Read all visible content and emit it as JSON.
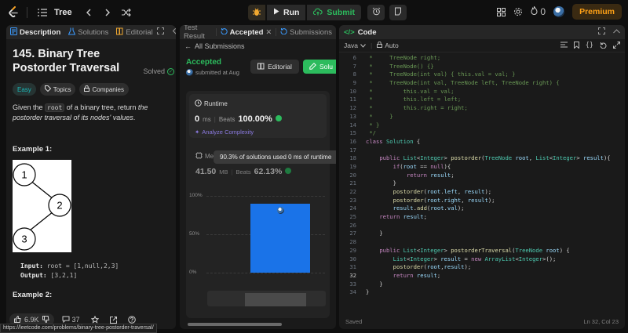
{
  "topbar": {
    "title": "Tree",
    "run_label": "Run",
    "submit_label": "Submit",
    "streak_count": "0",
    "premium_label": "Premium"
  },
  "description": {
    "tabs": [
      {
        "label": "Description"
      },
      {
        "label": "Solutions"
      },
      {
        "label": "Editorial"
      }
    ],
    "title": "145. Binary Tree Postorder Traversal",
    "status": "Solved",
    "tags": [
      "Easy",
      "Topics",
      "Companies"
    ],
    "text_before": "Given the ",
    "text_code": "root",
    "text_mid": " of a binary tree, return ",
    "text_em": "the postorder traversal of its nodes' values",
    "text_end": ".",
    "example1_title": "Example 1:",
    "tree_nodes": [
      "1",
      "2",
      "3"
    ],
    "input_label": "Input:",
    "input_value": "root = [1,null,2,3]",
    "output_label": "Output:",
    "output_value": "[3,2,1]",
    "example2_title": "Example 2:",
    "likes": "6.9K",
    "comments": "37"
  },
  "submission": {
    "tabs": [
      {
        "label": "Test Result"
      },
      {
        "label": "Accepted"
      },
      {
        "label": "Submissions"
      }
    ],
    "back_label": "All Submissions",
    "status": "Accepted",
    "submitted_text": "submitted at Aug",
    "editorial_label": "Editorial",
    "solution_label": "Solu",
    "runtime_label": "Runtime",
    "runtime_value": "0",
    "runtime_unit": "ms",
    "beats_label": "Beats",
    "runtime_beats": "100.00%",
    "analyze_label": "Analyze Complexity",
    "memory_label": "Memory",
    "memory_value": "41.50",
    "memory_unit": "MB",
    "memory_beats": "62.13%",
    "tooltip": "90.3% of solutions used 0 ms of runtime"
  },
  "chart_data": {
    "type": "bar",
    "y_ticks": [
      "100%",
      "50%",
      "0%"
    ],
    "ylim": [
      0,
      100
    ],
    "categories": [
      "0 ms"
    ],
    "values": [
      90.3
    ],
    "bar_color": "#1a73e8"
  },
  "code": {
    "title": "Code",
    "language": "Java",
    "mode": "Auto",
    "saved_label": "Saved",
    "cursor_pos": "Ln 32, Col 23",
    "lines": [
      {
        "n": "6",
        "t": " *     TreeNode right;"
      },
      {
        "n": "7",
        "t": " *     TreeNode() {}"
      },
      {
        "n": "8",
        "t": " *     TreeNode(int val) { this.val = val; }"
      },
      {
        "n": "9",
        "t": " *     TreeNode(int val, TreeNode left, TreeNode right) {"
      },
      {
        "n": "10",
        "t": " *         this.val = val;"
      },
      {
        "n": "11",
        "t": " *         this.left = left;"
      },
      {
        "n": "12",
        "t": " *         this.right = right;"
      },
      {
        "n": "13",
        "t": " *     }"
      },
      {
        "n": "14",
        "t": " * }"
      },
      {
        "n": "15",
        "t": " */"
      },
      {
        "n": "16",
        "t": "class Solution {"
      },
      {
        "n": "17",
        "t": ""
      },
      {
        "n": "18",
        "t": "    public List<Integer> postorder(TreeNode root, List<Integer> result){"
      },
      {
        "n": "19",
        "t": "        if(root == null){"
      },
      {
        "n": "20",
        "t": "            return result;"
      },
      {
        "n": "21",
        "t": "        }"
      },
      {
        "n": "22",
        "t": "        postorder(root.left, result);"
      },
      {
        "n": "23",
        "t": "        postorder(root.right, result);"
      },
      {
        "n": "24",
        "t": "        result.add(root.val);"
      },
      {
        "n": "25",
        "t": "    return result;"
      },
      {
        "n": "26",
        "t": ""
      },
      {
        "n": "27",
        "t": "    }"
      },
      {
        "n": "28",
        "t": ""
      },
      {
        "n": "29",
        "t": "    public List<Integer> postorderTraversal(TreeNode root) {"
      },
      {
        "n": "30",
        "t": "        List<Integer> result = new ArrayList<Integer>();"
      },
      {
        "n": "31",
        "t": "        postorder(root,result);"
      },
      {
        "n": "32",
        "t": "        return result;"
      },
      {
        "n": "33",
        "t": "    }"
      },
      {
        "n": "34",
        "t": "}"
      }
    ]
  },
  "status_url": "https://leetcode.com/problems/binary-tree-postorder-traversal/",
  "colors": {
    "accent_green": "#2cbb5d",
    "easy_teal": "#1cbaba",
    "premium_orange": "#ffa116",
    "bar_blue": "#1a73e8"
  }
}
